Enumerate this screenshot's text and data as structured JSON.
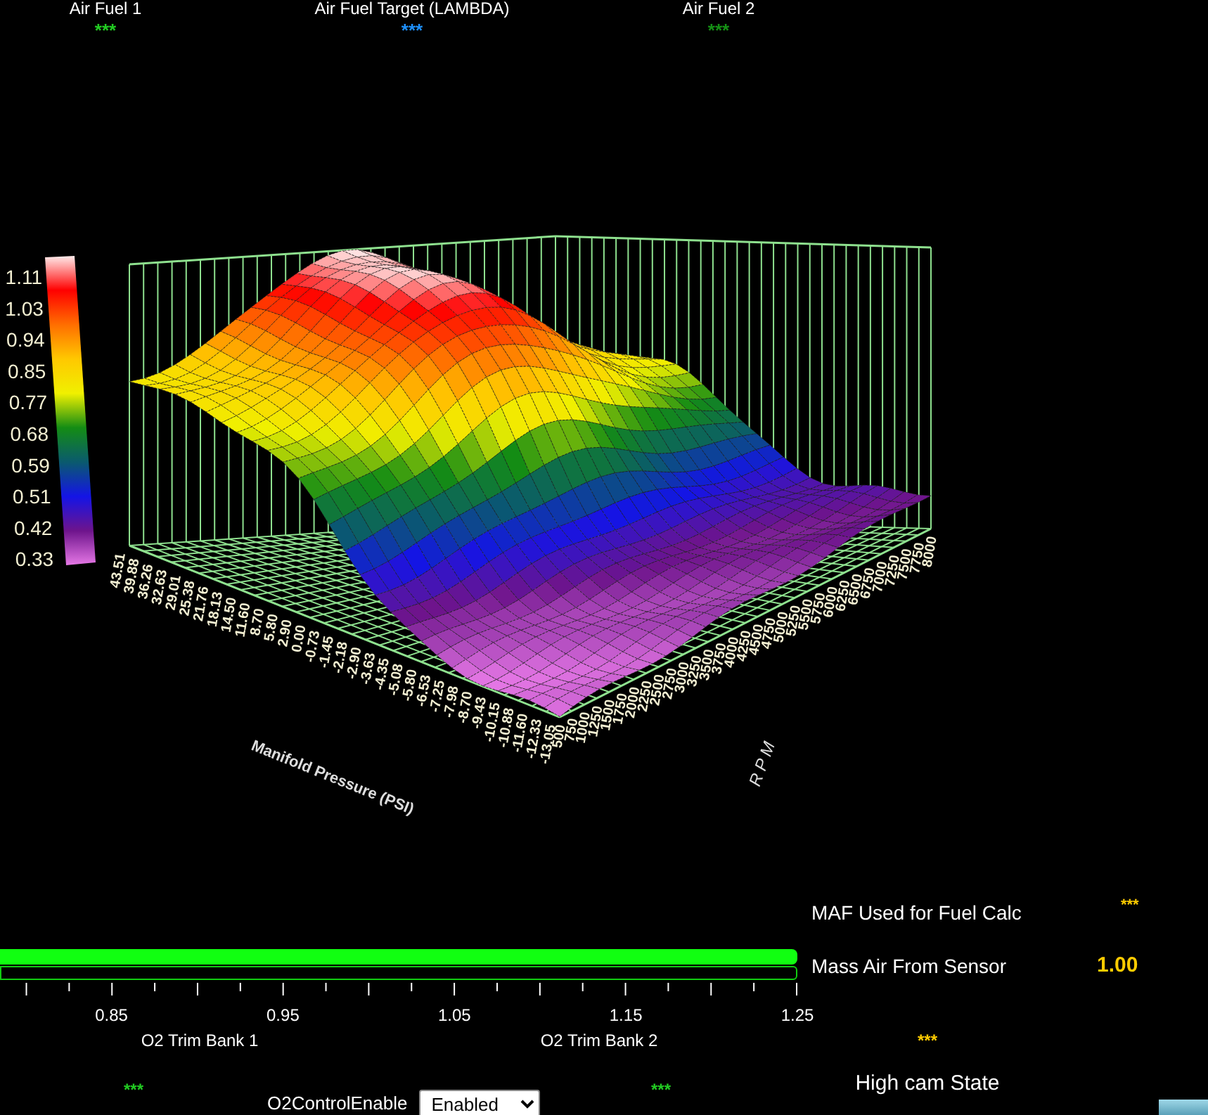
{
  "top_gauges": [
    {
      "title": "Air Fuel 1",
      "value": "***",
      "color": "#22cc22"
    },
    {
      "title": "Air Fuel Target (LAMBDA)",
      "value": "***",
      "color": "#1e90ff"
    },
    {
      "title": "Air Fuel 2",
      "value": "***",
      "color": "#159015"
    }
  ],
  "surface_plot": {
    "colorbar_labels": [
      "1.11",
      "1.03",
      "0.94",
      "0.85",
      "0.77",
      "0.68",
      "0.59",
      "0.51",
      "0.42",
      "0.33"
    ],
    "map_ticks": [
      "43.51",
      "39.88",
      "36.26",
      "32.63",
      "29.01",
      "25.38",
      "21.76",
      "18.13",
      "14.50",
      "11.60",
      "8.70",
      "5.80",
      "2.90",
      "0.00",
      "-0.73",
      "-1.45",
      "-2.18",
      "-2.90",
      "-3.63",
      "-4.35",
      "-5.08",
      "-5.80",
      "-6.53",
      "-7.25",
      "-7.98",
      "-8.70",
      "-9.43",
      "-10.15",
      "-10.88",
      "-11.60",
      "-12.33",
      "-13.05"
    ],
    "rpm_ticks": [
      "500",
      "750",
      "1000",
      "1250",
      "1500",
      "1750",
      "2000",
      "2250",
      "2500",
      "2750",
      "3000",
      "3250",
      "3500",
      "3750",
      "4000",
      "4250",
      "4500",
      "4750",
      "5000",
      "5250",
      "5500",
      "5750",
      "6000",
      "6250",
      "6500",
      "6750",
      "7000",
      "7250",
      "7500",
      "7750",
      "8000"
    ],
    "xlabel": "Manifold Pressure (PSI)",
    "ylabel": "RPM"
  },
  "o2_trim": {
    "bars": [
      {
        "level": 1
      },
      {
        "level": 0
      }
    ],
    "scale_labels": [
      "0.85",
      "0.95",
      "1.05",
      "1.15",
      "1.25"
    ],
    "banks": [
      {
        "label": "O2 Trim Bank 1",
        "value": "***"
      },
      {
        "label": "O2 Trim Bank 2",
        "value": "***"
      }
    ],
    "control": {
      "label": "O2ControlEnable",
      "value": "Enabled"
    }
  },
  "maf": [
    {
      "label": "MAF Used for Fuel Calc",
      "value": "***"
    },
    {
      "label": "Mass Air From Sensor",
      "value": "1.00"
    }
  ],
  "high_cam": {
    "value": "***",
    "label": "High cam State"
  }
}
